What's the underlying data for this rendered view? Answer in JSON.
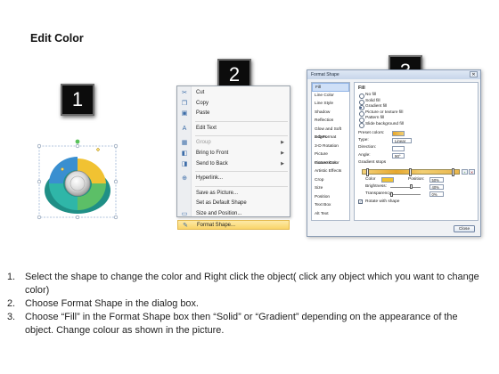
{
  "title": "Edit Color",
  "step_numbers": [
    "1",
    "2",
    "3"
  ],
  "context_menu": {
    "items": [
      {
        "label": "Cut",
        "icon": "scissors-icon",
        "glyph": "✂",
        "type": "item"
      },
      {
        "label": "Copy",
        "icon": "copy-icon",
        "glyph": "❐",
        "type": "item"
      },
      {
        "label": "Paste",
        "icon": "paste-icon",
        "glyph": "▣",
        "type": "item"
      },
      {
        "type": "separator"
      },
      {
        "label": "Edit Text",
        "icon": "edit-text-icon",
        "glyph": "A",
        "type": "item"
      },
      {
        "type": "separator"
      },
      {
        "label": "Group",
        "icon": "group-icon",
        "glyph": "▦",
        "type": "item",
        "disabled": true,
        "submenu": true
      },
      {
        "label": "Bring to Front",
        "icon": "bring-front-icon",
        "glyph": "◧",
        "type": "item",
        "submenu": true
      },
      {
        "label": "Send to Back",
        "icon": "send-back-icon",
        "glyph": "◨",
        "type": "item",
        "submenu": true
      },
      {
        "type": "separator"
      },
      {
        "label": "Hyperlink...",
        "icon": "hyperlink-icon",
        "glyph": "⊕",
        "type": "item"
      },
      {
        "type": "separator"
      },
      {
        "label": "Save as Picture...",
        "icon": "",
        "glyph": "",
        "type": "item"
      },
      {
        "label": "Set as Default Shape",
        "icon": "",
        "glyph": "",
        "type": "item"
      },
      {
        "label": "Size and Position...",
        "icon": "size-icon",
        "glyph": "▭",
        "type": "item"
      },
      {
        "label": "Format Shape...",
        "icon": "format-shape-icon",
        "glyph": "✎",
        "type": "item",
        "highlighted": true
      }
    ]
  },
  "dialog": {
    "title": "Format Shape",
    "close_glyph": "✕",
    "categories": [
      "Fill",
      "Line Color",
      "Line Style",
      "Shadow",
      "Reflection",
      "Glow and Soft Edges",
      "3-D Format",
      "3-D Rotation",
      "Picture Corrections",
      "Picture Color",
      "Artistic Effects",
      "Crop",
      "Size",
      "Position",
      "Text Box",
      "Alt Text"
    ],
    "selected_category": "Fill",
    "section_heading": "Fill",
    "fill_options": [
      "No fill",
      "Solid fill",
      "Gradient fill",
      "Picture or texture fill",
      "Pattern fill",
      "Slide background fill"
    ],
    "selected_fill": "Gradient fill",
    "preset_colors_label": "Preset colors:",
    "type_label": "Type:",
    "type_value": "Linear",
    "direction_label": "Direction:",
    "angle_label": "Angle:",
    "angle_value": "90°",
    "gradient_stops_label": "Gradient stops",
    "color_label": "Color",
    "position_label": "Position:",
    "position_value": "50%",
    "brightness_label": "Brightness:",
    "brightness_value": "40%",
    "brightness_level": 0.7,
    "transparency_label": "Transparency:",
    "transparency_value": "0%",
    "transparency_level": 0.0,
    "rotate_label": "Rotate with shape",
    "rotate_checked": true,
    "close_label": "Close"
  },
  "colors": {
    "ring_blue": "#3a8fd0",
    "ring_yellow": "#f1c232",
    "ring_green": "#5cbf67",
    "ring_teal": "#2fb6a8",
    "menu_highlight": "#f9d56a"
  },
  "instructions": [
    {
      "num": "1.",
      "text": "Select the shape to change the color and Right click the object( click any object which you want to change color)"
    },
    {
      "num": "2.",
      "text": "Choose Format Shape in the dialog box."
    },
    {
      "num": "3.",
      "text": "Choose “Fill” in the Format Shape box then “Solid” or “Gradient” depending on the appearance of the object. Change colour as shown in the picture."
    }
  ]
}
